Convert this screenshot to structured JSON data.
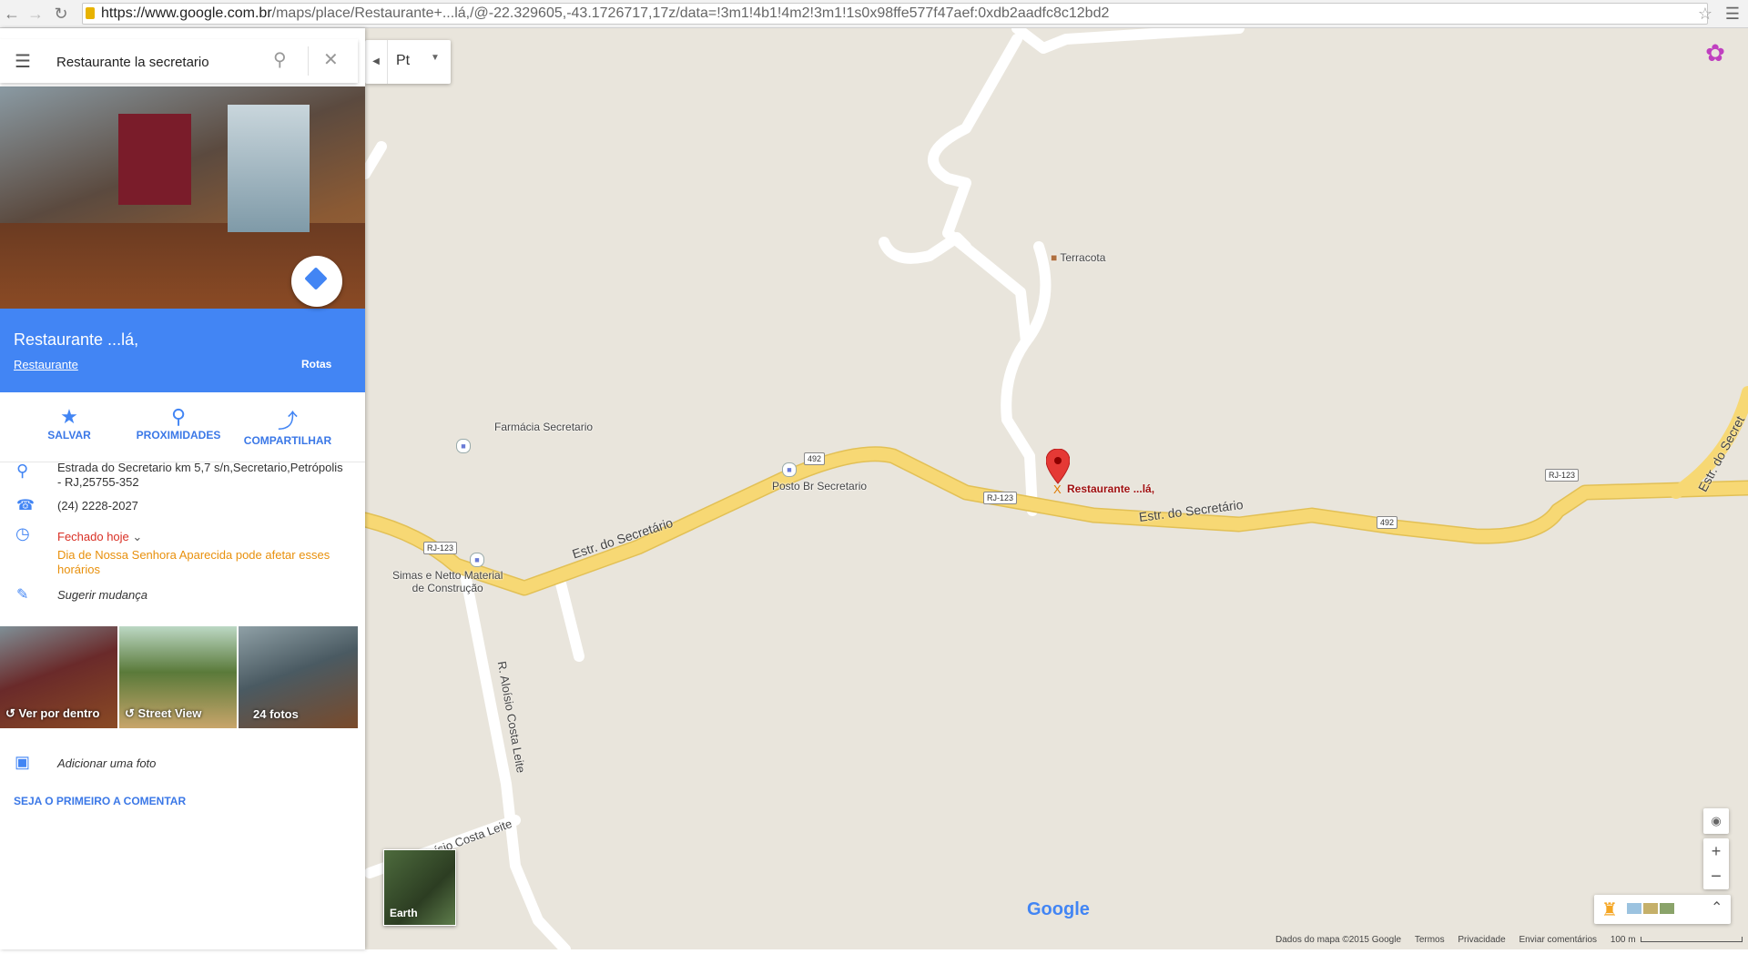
{
  "browser": {
    "url_host": "https://www.google.com.br",
    "url_rest": "/maps/place/Restaurante+...lá,/@-22.329605,-43.1726717,17z/data=!3m1!4b1!4m2!3m1!1s0x98ffe577f47aef:0xdb2aadfc8c12bd2"
  },
  "search": {
    "value": "Restaurante la secretario"
  },
  "language": {
    "label": "Pt"
  },
  "place": {
    "name": "Restaurante ...lá,",
    "category": "Restaurante",
    "directions_label": "Rotas"
  },
  "actions": {
    "save": "SALVAR",
    "nearby": "PROXIMIDADES",
    "share": "COMPARTILHAR"
  },
  "info": {
    "address_line1": "Estrada do Secretario km 5,7 s/n,Secretario,Petrópolis",
    "address_line2": "- RJ,25755-352",
    "phone": "(24) 2228-2027",
    "hours_status": "Fechado hoje",
    "holiday_line1": "Dia de Nossa Senhora Aparecida pode afetar esses",
    "holiday_line2": "horários",
    "suggest_edit": "Sugerir mudança"
  },
  "photos": [
    {
      "caption": "Ver por dentro"
    },
    {
      "caption": "Street View"
    },
    {
      "caption": "24 fotos"
    }
  ],
  "add_photo": "Adicionar uma foto",
  "first_review": "SEJA O PRIMEIRO A COMENTAR",
  "map": {
    "labels": {
      "terracota": "Terracota",
      "farmacia": "Farmácia Secretario",
      "posto": "Posto Br Secretario",
      "simas_line1": "Simas e Netto Material",
      "simas_line2": "de Construção",
      "marker": "Restaurante ...lá,"
    },
    "roads": {
      "estr1": "Estr. do Secretário",
      "estr2": "Estr. do Secretário",
      "estr3": "Estr. do Secret",
      "aloisio1": "R. Aloísio Costa Leite",
      "aloisio2": "R. Aloísio Costa Leite"
    },
    "shields": {
      "s492a": "492",
      "rj123a": "RJ-123",
      "rj123b": "RJ-123",
      "rj123c": "RJ-123",
      "s492b": "492"
    },
    "earth_label": "Earth",
    "google_logo": "Google",
    "footer": {
      "data": "Dados do mapa ©2015 Google",
      "terms": "Termos",
      "privacy": "Privacidade",
      "feedback": "Enviar comentários",
      "scale": "100 m"
    }
  },
  "colors": {
    "accent": "#4285f4",
    "road_major": "#f7d874",
    "map_bg": "#e9e5dc",
    "marker": "#e53935",
    "closed": "#d93025",
    "warning": "#e8900c"
  }
}
